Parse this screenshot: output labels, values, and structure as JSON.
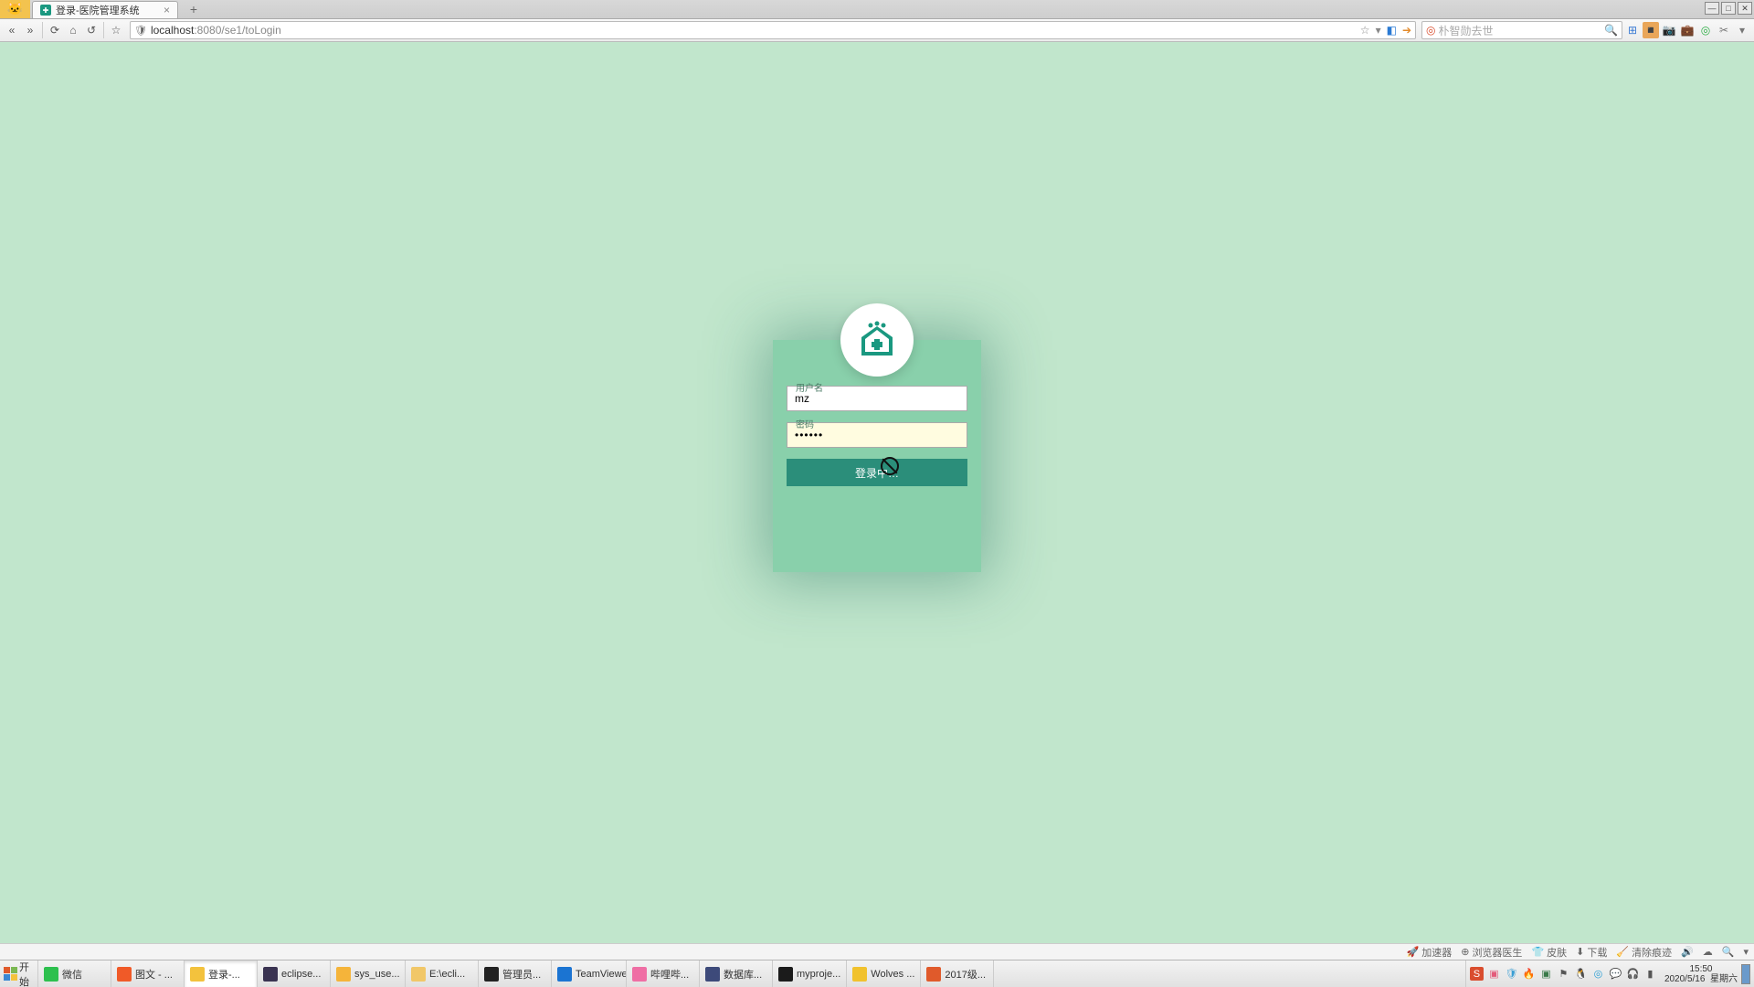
{
  "window": {
    "tab_title": "登录-医院管理系统"
  },
  "browser": {
    "url_host": "localhost",
    "url_port": ":8080",
    "url_path": "/se1/toLogin",
    "search_placeholder": "朴智勋去世"
  },
  "login": {
    "username_label": "用户名",
    "password_label": "密码",
    "username_value": "mz",
    "password_value": "••••••",
    "submit_label": "登录中…"
  },
  "status": {
    "accel": "加速器",
    "doctor": "浏览器医生",
    "skin": "皮肤",
    "download": "下载",
    "clear": "清除痕迹"
  },
  "taskbar": {
    "start": "开始",
    "items": [
      {
        "label": "微信",
        "color": "#2dc04e"
      },
      {
        "label": "图文 - ...",
        "color": "#f05a28"
      },
      {
        "label": "登录-...",
        "color": "#f3c23d"
      },
      {
        "label": "eclipse...",
        "color": "#3a3351"
      },
      {
        "label": "sys_use...",
        "color": "#f5b43a"
      },
      {
        "label": "E:\\ecli...",
        "color": "#f1c768"
      },
      {
        "label": "管理员...",
        "color": "#222"
      },
      {
        "label": "TeamViewer",
        "color": "#1b74d2"
      },
      {
        "label": "哔哩哔...",
        "color": "#ef6ea4"
      },
      {
        "label": "数据库...",
        "color": "#3d4a7a"
      },
      {
        "label": "myproje...",
        "color": "#1b1b1b"
      },
      {
        "label": "Wolves ...",
        "color": "#f1c22d"
      },
      {
        "label": "2017级...",
        "color": "#e05a2b"
      }
    ],
    "clock_time": "15:50",
    "clock_date": "2020/5/16",
    "clock_day": "星期六"
  }
}
